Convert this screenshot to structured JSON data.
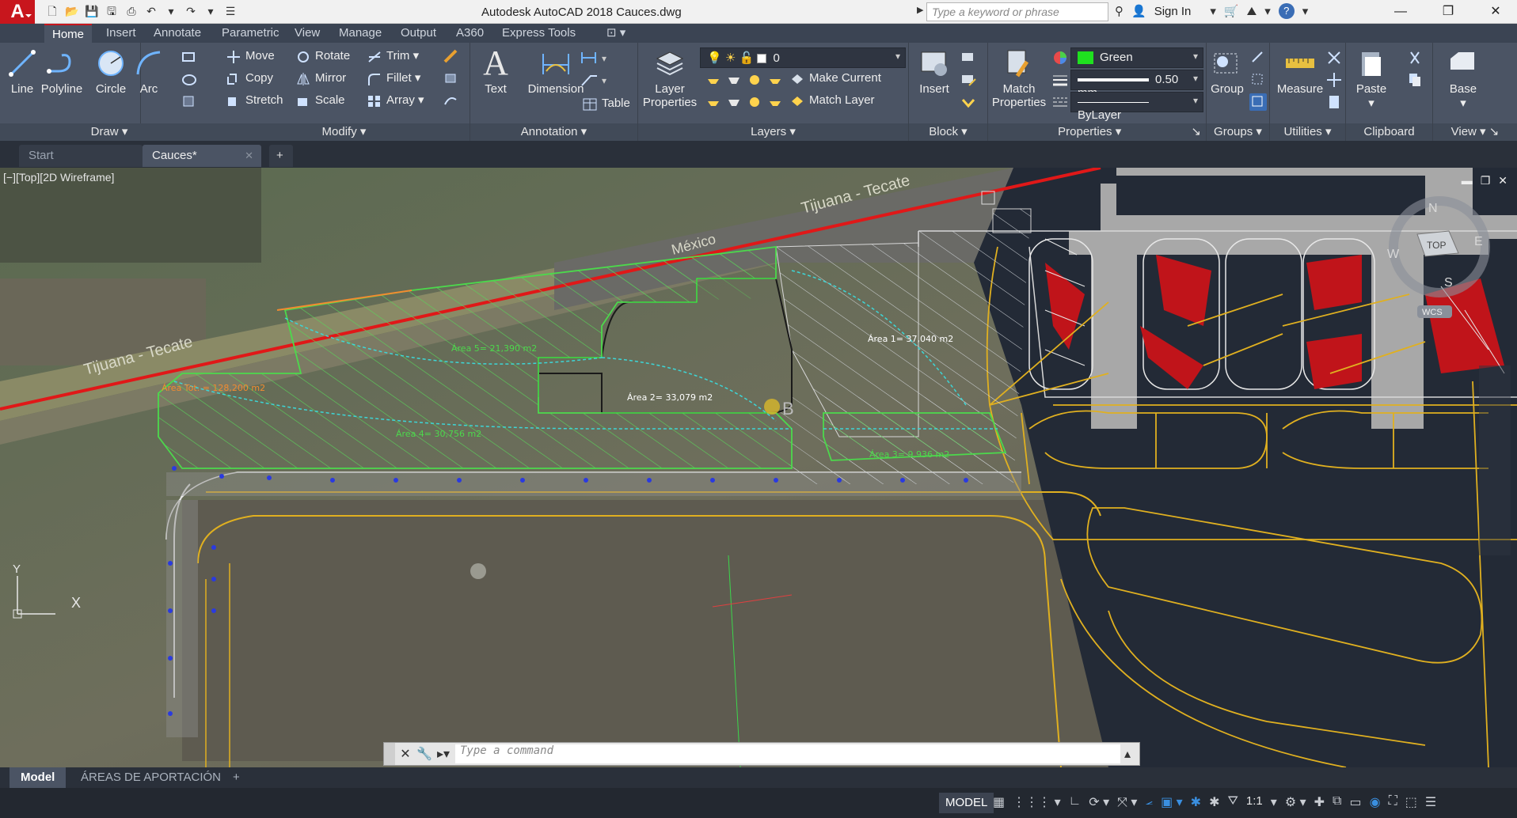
{
  "window": {
    "app_logo": "A",
    "title": "Autodesk AutoCAD 2018    Cauces.dwg",
    "search_placeholder": "Type a keyword or phrase",
    "sign_in": "Sign In",
    "minimize": "—",
    "maximize": "❐",
    "close": "✕"
  },
  "ribbon_tabs": [
    "Home",
    "Insert",
    "Annotate",
    "Parametric",
    "View",
    "Manage",
    "Output",
    "A360",
    "Express Tools"
  ],
  "panels": {
    "draw": {
      "title": "Draw",
      "line": "Line",
      "polyline": "Polyline",
      "circle": "Circle",
      "arc": "Arc"
    },
    "modify": {
      "title": "Modify",
      "move": "Move",
      "rotate": "Rotate",
      "trim": "Trim",
      "copy": "Copy",
      "mirror": "Mirror",
      "fillet": "Fillet",
      "stretch": "Stretch",
      "scale": "Scale",
      "array": "Array"
    },
    "annotation": {
      "title": "Annotation",
      "text": "Text",
      "dimension": "Dimension",
      "table": "Table"
    },
    "layers": {
      "title": "Layers",
      "layer_properties_1": "Layer",
      "layer_properties_2": "Properties",
      "current_layer": "0",
      "make_current": "Make Current",
      "match_layer": "Match Layer"
    },
    "block": {
      "title": "Block",
      "insert": "Insert"
    },
    "properties": {
      "title": "Properties",
      "match_1": "Match",
      "match_2": "Properties",
      "color": "Green",
      "lineweight": "0.50 mm",
      "linetype": "ByLayer"
    },
    "groups": {
      "title": "Groups",
      "group": "Group"
    },
    "utilities": {
      "title": "Utilities",
      "measure": "Measure"
    },
    "clipboard": {
      "title": "Clipboard",
      "paste": "Paste"
    },
    "view": {
      "title": "View",
      "base": "Base"
    }
  },
  "file_tabs": {
    "start": "Start",
    "current": "Cauces*"
  },
  "viewport": {
    "label": "[−][Top][2D Wireframe]",
    "viewcube_top": "TOP",
    "viewcube_n": "N",
    "viewcube_s": "S",
    "viewcube_e": "E",
    "viewcube_w": "W",
    "wcs": "WCS",
    "ucs_y": "Y",
    "ucs_x": "X",
    "annotations": {
      "area1": "Área 1= 37,040 m2",
      "area2": "Área 2= 33,079 m2",
      "area3": "Área 3= 9,936 m2",
      "area4": "Área 4= 30,756 m2",
      "area5": "Área 5= 21,390 m2",
      "area_total": "Área Tot. = 128,200 m2",
      "road_1": "Tijuana - Tecate",
      "road_2": "Tijuana - Tecate",
      "mexico": "México"
    },
    "command_placeholder": "Type a command"
  },
  "layout_tabs": {
    "model": "Model",
    "layout": "ÁREAS DE APORTACIÓN"
  },
  "status": {
    "model": "MODEL",
    "scale": "1:1"
  },
  "colors": {
    "accent": "#c8161d",
    "green_poly": "#4cd94c",
    "cyan_line": "#3dd6d6",
    "yellow_line": "#e0b020",
    "red_border": "#e01818"
  }
}
